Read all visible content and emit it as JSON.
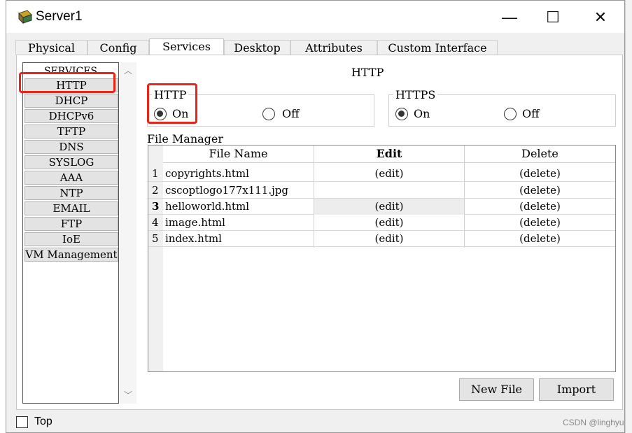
{
  "window": {
    "title": "Server1",
    "minimize": "—",
    "maximize": "☐",
    "close": "✕"
  },
  "tabs": [
    "Physical",
    "Config",
    "Services",
    "Desktop",
    "Attributes",
    "Custom Interface"
  ],
  "active_tab": "Services",
  "services": {
    "header": "SERVICES",
    "items": [
      "HTTP",
      "DHCP",
      "DHCPv6",
      "TFTP",
      "DNS",
      "SYSLOG",
      "AAA",
      "NTP",
      "EMAIL",
      "FTP",
      "IoE",
      "VM Management"
    ],
    "selected": "HTTP"
  },
  "http_panel": {
    "title": "HTTP",
    "http": {
      "label": "HTTP",
      "on": "On",
      "off": "Off",
      "value": "On"
    },
    "https": {
      "label": "HTTPS",
      "on": "On",
      "off": "Off",
      "value": "On"
    }
  },
  "file_manager": {
    "title": "File Manager",
    "columns": [
      "File Name",
      "Edit",
      "Delete"
    ],
    "rows": [
      {
        "num": "1",
        "name": "copyrights.html",
        "edit": "(edit)",
        "delete": "(delete)"
      },
      {
        "num": "2",
        "name": "cscoptlogo177x111.jpg",
        "edit": "",
        "delete": "(delete)"
      },
      {
        "num": "3",
        "name": "helloworld.html",
        "edit": "(edit)",
        "delete": "(delete)"
      },
      {
        "num": "4",
        "name": "image.html",
        "edit": "(edit)",
        "delete": "(delete)"
      },
      {
        "num": "5",
        "name": "index.html",
        "edit": "(edit)",
        "delete": "(delete)"
      }
    ]
  },
  "buttons": {
    "new_file": "New File",
    "import": "Import"
  },
  "bottom": {
    "top_label": "Top",
    "top_checked": false
  },
  "watermark": "CSDN @linghyu",
  "colors": {
    "highlight": "#e8251a"
  }
}
